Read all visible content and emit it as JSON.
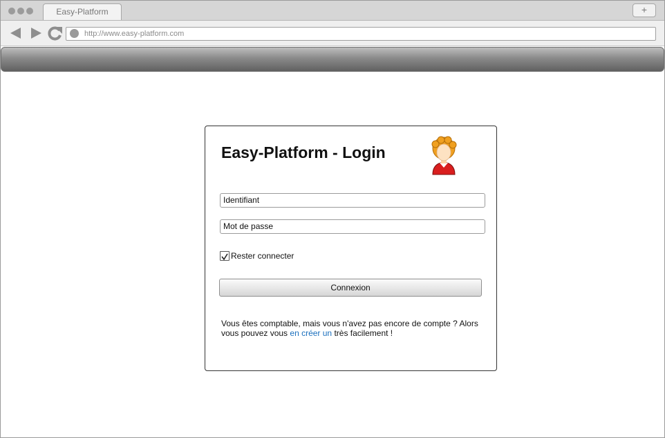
{
  "browser": {
    "tab_label": "Easy-Platform",
    "new_tab_symbol": "+",
    "url": "http://www.easy-platform.com"
  },
  "login": {
    "title": "Easy-Platform - Login",
    "username_value": "Identifiant",
    "password_value": "Mot de passe",
    "remember_label": "Rester connecter",
    "remember_checked": true,
    "submit_label": "Connexion",
    "info_text_1": "Vous êtes comptable, mais vous n'avez pas encore de compte ? Alors vous pouvez vous ",
    "info_link": "en créer un",
    "info_text_2": " très facilement !"
  },
  "icons": {
    "back": "arrow-left-icon",
    "forward": "arrow-right-icon",
    "reload": "reload-icon",
    "avatar": "user-avatar-icon",
    "checkbox": "checkmark-icon"
  },
  "colors": {
    "link": "#1a6fbd",
    "toolbar_dark": "#616161",
    "avatar_hair": "#f0a020",
    "avatar_shirt": "#d91e1e"
  }
}
